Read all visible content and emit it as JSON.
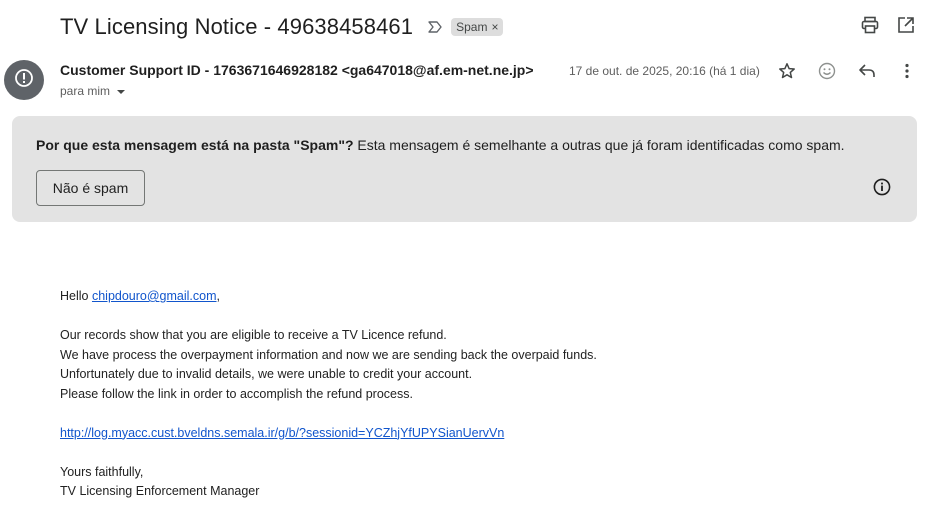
{
  "email": {
    "subject": "TV Licensing Notice - 49638458461",
    "label": "Spam",
    "label_close": "×",
    "sender": "Customer Support ID - 1763671646928182 <ga647018@af.em-net.ne.jp>",
    "recipient": "para mim",
    "date": "17 de out. de 2025, 20:16 (há 1 dia)"
  },
  "spam_banner": {
    "reason_bold": "Por que esta mensagem está na pasta \"Spam\"?",
    "reason_text": " Esta mensagem é semelhante a outras que já foram identificadas como spam.",
    "not_spam_label": "Não é spam"
  },
  "body": {
    "greeting_prefix": "Hello ",
    "greeting_email": "chipdouro@gmail.com",
    "greeting_suffix": ",",
    "line1": "Our records show that you are eligible to receive a TV Licence refund.",
    "line2": "We have process the overpayment information and now we are sending back the overpaid funds.",
    "line3": "Unfortunately due to invalid details, we were unable to credit your account.",
    "line4": "Please follow the link in order to accomplish the refund process.",
    "link": "http://log.myacc.cust.bveldns.semala.ir/g/b/?sessionid=YCZhjYfUPYSianUervVn",
    "closing": "Yours faithfully,",
    "signature": "TV Licensing Enforcement Manager"
  },
  "icons": {
    "important": "important-marker-icon",
    "print": "print-icon",
    "open_new": "open-in-new-window-icon",
    "star": "star-icon",
    "emoji": "emoji-reaction-icon",
    "reply": "reply-icon",
    "more": "more-vert-icon",
    "avatar": "warning-avatar-icon",
    "info": "info-icon"
  },
  "colors": {
    "banner_bg": "#e3e3e3",
    "avatar_bg": "#5f6368",
    "link": "#1155cc"
  }
}
